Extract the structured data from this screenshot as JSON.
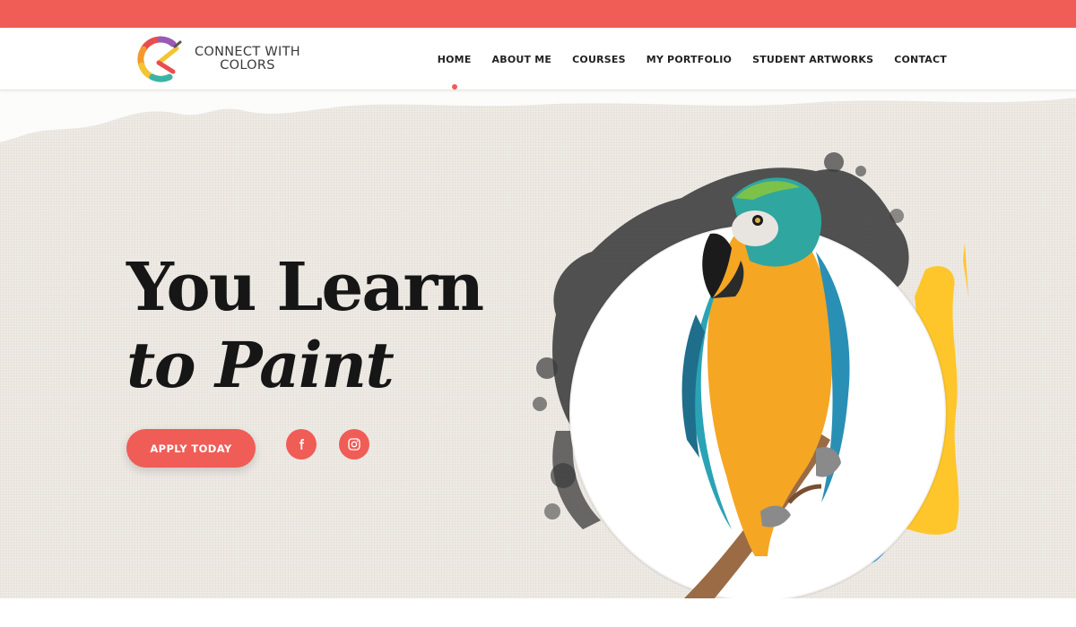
{
  "brand": {
    "logo_line1": "CONNECT WITH",
    "logo_line2": "COLORS"
  },
  "nav": {
    "items": [
      {
        "label": "HOME",
        "active": true
      },
      {
        "label": "ABOUT ME",
        "active": false
      },
      {
        "label": "COURSES",
        "active": false
      },
      {
        "label": "MY PORTFOLIO",
        "active": false
      },
      {
        "label": "STUDENT ARTWORKS",
        "active": false
      },
      {
        "label": "CONTACT",
        "active": false
      }
    ]
  },
  "hero": {
    "headline_line1": "You Learn",
    "headline_line2": "to Paint",
    "cta_label": "APPLY TODAY"
  },
  "social": {
    "facebook_icon": "facebook-icon",
    "instagram_icon": "instagram-icon"
  },
  "colors": {
    "accent": "#ef5d56",
    "background": "#ece7e1",
    "text": "#161616",
    "brush_yellow": "#ffc62b",
    "brush_blue": "#5aa9e6"
  }
}
